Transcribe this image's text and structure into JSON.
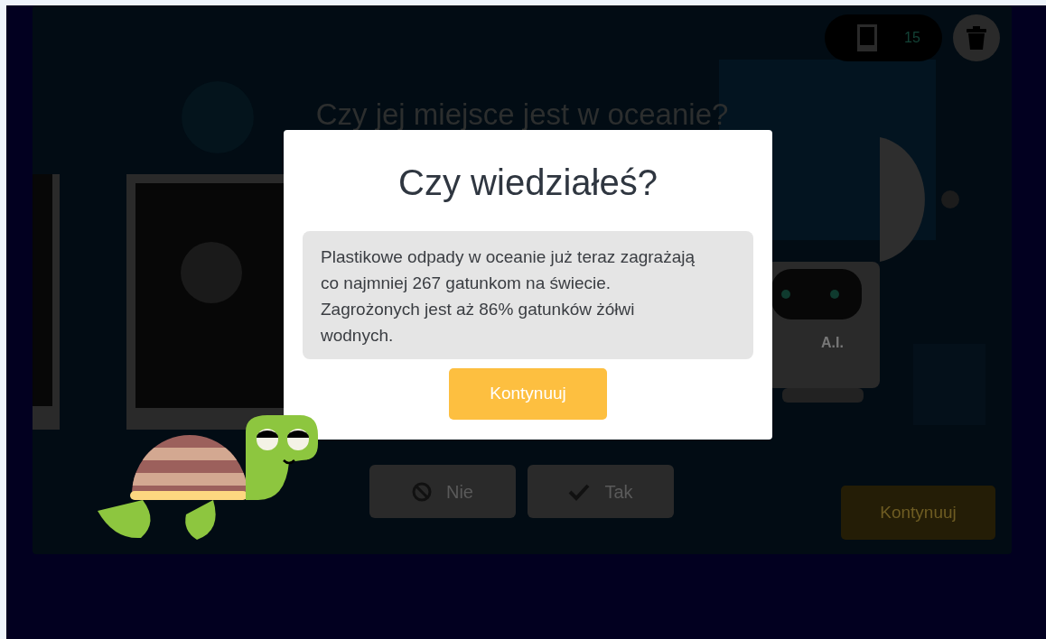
{
  "scene": {
    "question": "Czy jej miejsce jest w oceanie?",
    "counter": "15",
    "robot_label": "A.I.",
    "answer_buttons": [
      {
        "label": "Nie",
        "kind": "no"
      },
      {
        "label": "Tak",
        "kind": "yes"
      }
    ],
    "continue_button": "Kontynuuj"
  },
  "dialog": {
    "title": "Czy wiedziałeś?",
    "message": "Plastikowe odpady w oceanie już teraz zagrażają co najmniej 267 gatunkom na świecie. Zagrożonych jest aż 86% gatunków żółwi wodnych.",
    "button": "Kontynuuj"
  }
}
